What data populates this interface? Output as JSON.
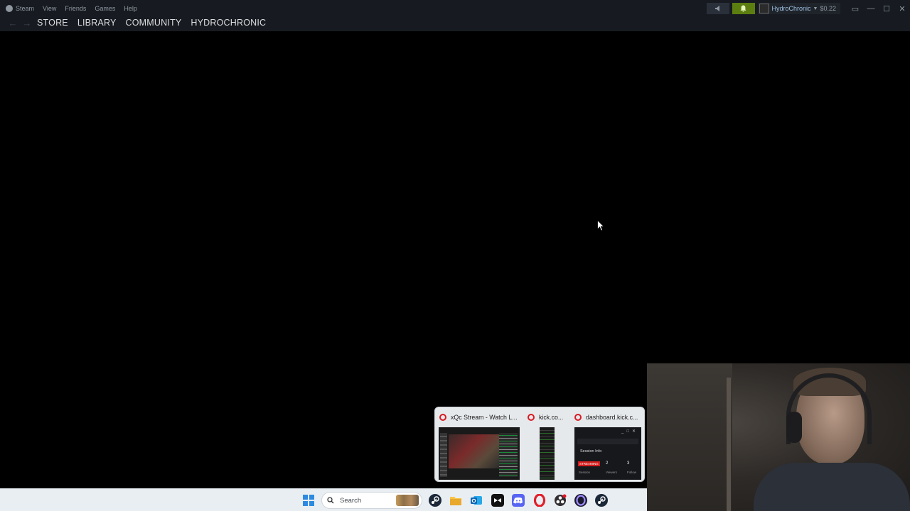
{
  "menu": {
    "steam": "Steam",
    "view": "View",
    "friends": "Friends",
    "games": "Games",
    "help": "Help"
  },
  "nav": {
    "tabs": [
      "STORE",
      "LIBRARY",
      "COMMUNITY",
      "HYDROCHRONIC"
    ]
  },
  "account": {
    "name": "HydroChronic",
    "balance": "$0.22"
  },
  "taskbar": {
    "search_label": "Search",
    "pinned_icons": [
      "steam-icon",
      "file-explorer-icon",
      "outlook-icon",
      "capcut-icon",
      "discord-icon",
      "opera-icon",
      "obs-icon",
      "opera-gx-icon",
      "steam-icon"
    ]
  },
  "popup": {
    "windows": [
      {
        "title": "xQc Stream - Watch L..."
      },
      {
        "title": "kick.co..."
      },
      {
        "title": "dashboard.kick.c..."
      }
    ],
    "dashboard_preview": {
      "session_label": "Session Info",
      "status": "STREAMING",
      "viewers_count": "2",
      "followers_count": "3",
      "col_session": "Session",
      "col_viewers": "Viewers",
      "col_follows": "Follow"
    }
  },
  "colors": {
    "titlebar": "#171a21",
    "notification_green": "#5c7e10",
    "opera_red": "#d81a22",
    "taskbar": "#e9eef3"
  }
}
